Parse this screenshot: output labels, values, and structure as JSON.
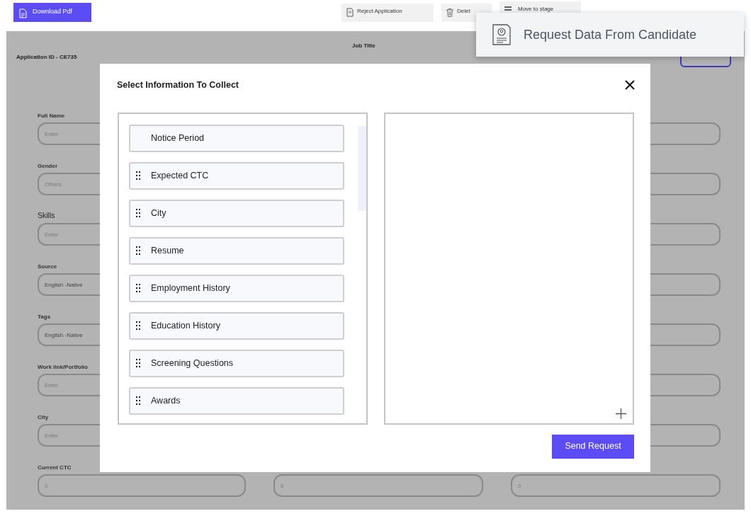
{
  "toolbar": {
    "download_button": "Download Pdf",
    "actions": [
      {
        "kind": "reject",
        "label": "Reject Application"
      },
      {
        "kind": "delete",
        "label": "Delet"
      },
      {
        "kind": "move",
        "label": "Move to stage"
      }
    ]
  },
  "tooltip": {
    "text": "Request Data From Candidate"
  },
  "header": {
    "application_id": "Application ID - CE735",
    "job_title_label": "Job Title"
  },
  "form": {
    "rows": [
      {
        "label": "Full Name",
        "large": false,
        "fields": [
          {
            "placeholder": "Enter"
          }
        ]
      },
      {
        "label": "Gender",
        "large": false,
        "fields": [
          {
            "placeholder": "Others"
          }
        ]
      },
      {
        "label": "Skills",
        "large": true,
        "fields": [
          {
            "placeholder": "Enter"
          }
        ]
      },
      {
        "label": "Source",
        "large": false,
        "fields": [
          {
            "value": "English -Native"
          }
        ]
      },
      {
        "label": "Tags",
        "large": false,
        "fields": [
          {
            "value": "English -Native"
          }
        ]
      },
      {
        "label": "Work link/Portfolio",
        "large": false,
        "fields": [
          {
            "placeholder": "Enter"
          }
        ]
      },
      {
        "label": "City",
        "large": false,
        "fields": [
          {
            "placeholder": "Enter"
          }
        ]
      },
      {
        "label": "Current CTC",
        "large": false,
        "fields": [
          {
            "placeholder": "0"
          },
          {
            "placeholder": "0"
          },
          {
            "placeholder": "0"
          }
        ]
      }
    ]
  },
  "modal": {
    "title": "Select Information To Collect",
    "items": [
      {
        "label": "Notice Period",
        "drag_handle": false
      },
      {
        "label": "Expected CTC",
        "drag_handle": true
      },
      {
        "label": "City",
        "drag_handle": true
      },
      {
        "label": "Resume",
        "drag_handle": true
      },
      {
        "label": "Employment History",
        "drag_handle": true
      },
      {
        "label": "Education History",
        "drag_handle": true
      },
      {
        "label": "Screening Questions",
        "drag_handle": true
      },
      {
        "label": "Awards",
        "drag_handle": true
      }
    ],
    "send_button": "Send Request"
  }
}
